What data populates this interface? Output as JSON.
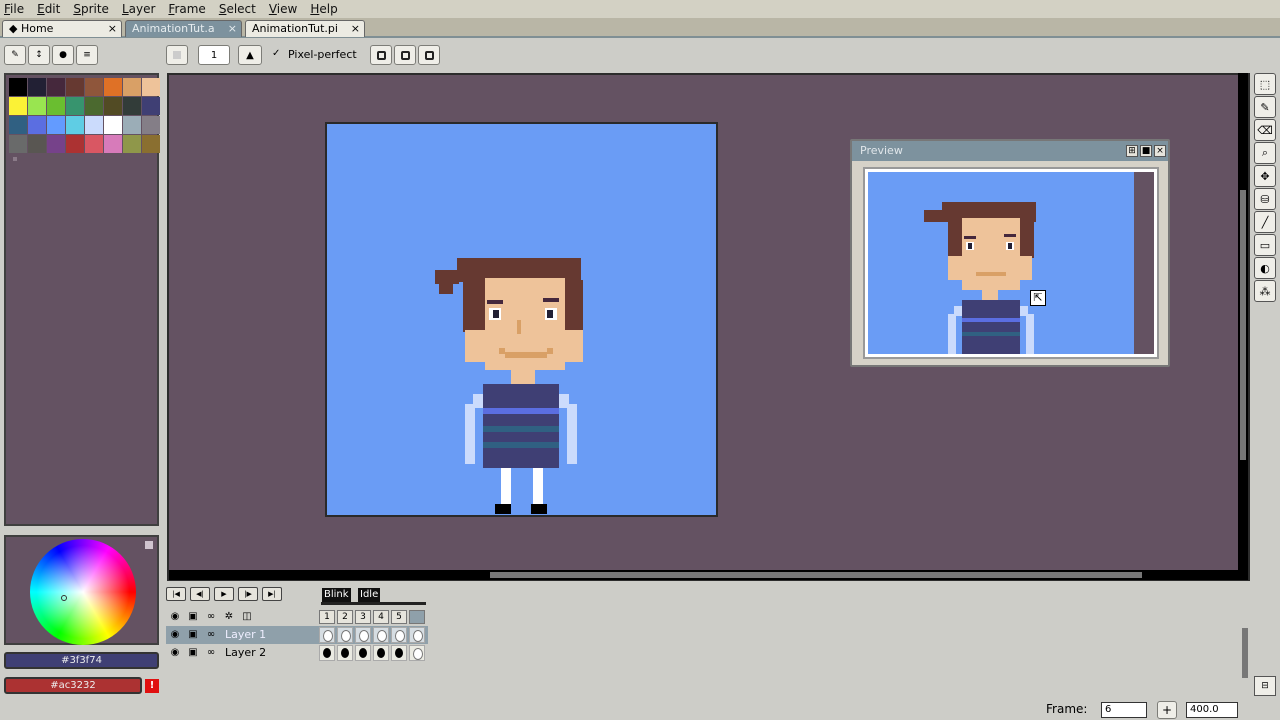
{
  "menu": [
    "File",
    "Edit",
    "Sprite",
    "Layer",
    "Frame",
    "Select",
    "View",
    "Help"
  ],
  "tabs": {
    "home": "Home",
    "file1": "AnimationTut.a",
    "file2": "AnimationTut.pi",
    "close": "×"
  },
  "context_bar": {
    "brush_size": "1",
    "pixel_perfect_label": "Pixel-perfect"
  },
  "palette": {
    "colors": [
      "#000000",
      "#222034",
      "#45283c",
      "#663931",
      "#8f563b",
      "#df7126",
      "#d9a066",
      "#eec39a",
      "#fbf236",
      "#99e550",
      "#6abe30",
      "#37946e",
      "#4b692f",
      "#524b24",
      "#323c39",
      "#3f3f74",
      "#306082",
      "#5b6ee1",
      "#639bff",
      "#5fcde4",
      "#cbdbfc",
      "#ffffff",
      "#9badb7",
      "#847e87",
      "#696a6a",
      "#595652",
      "#76428a",
      "#ac3232",
      "#d95763",
      "#d77bba",
      "#8f974a",
      "#8a6f30"
    ]
  },
  "colors": {
    "foreground": "#3f3f74",
    "background": "#ac3232",
    "foreground_label": "#3f3f74",
    "background_label": "#ac3232",
    "canvas_bg": "#6a9cf5",
    "editor_bg": "#645262"
  },
  "preview": {
    "title": "Preview"
  },
  "animation": {
    "tags": [
      "Blink",
      "Idle"
    ],
    "frames": [
      "1",
      "2",
      "3",
      "4",
      "5"
    ],
    "layers": [
      {
        "name": "Layer 1",
        "selected": true
      },
      {
        "name": "Layer 2",
        "selected": false
      }
    ]
  },
  "status": {
    "frame_label": "Frame:",
    "frame_value": "6",
    "zoom": "400.0"
  },
  "icons": {
    "tools": [
      "marquee-icon",
      "pencil-icon",
      "eraser-icon",
      "zoom-icon",
      "move-icon",
      "paint-bucket-icon",
      "line-icon",
      "rectangle-icon",
      "ellipse-icon",
      "blur-icon"
    ]
  }
}
